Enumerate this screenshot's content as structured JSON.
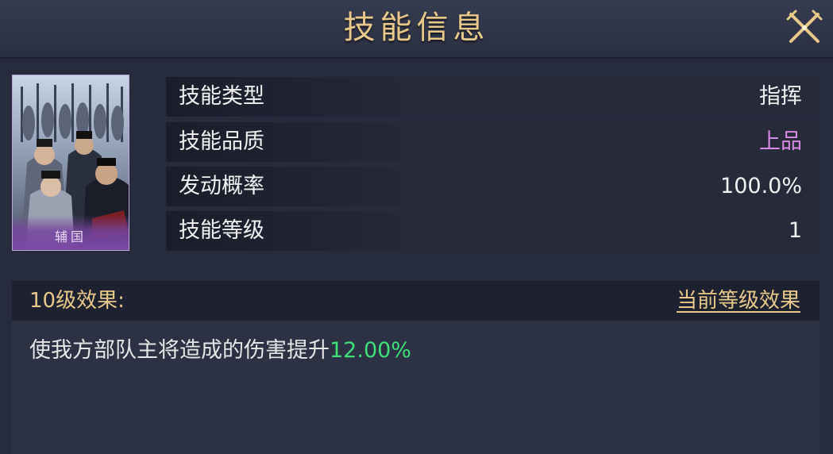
{
  "header": {
    "title": "技能信息",
    "close_icon": "close-crossed-swords-icon"
  },
  "card": {
    "name": "辅国",
    "frame_color": "#b9a8d8",
    "band_color": "#7a48a6"
  },
  "info_rows": [
    {
      "label": "技能类型",
      "value": "指挥",
      "value_color": "#f2f2f2"
    },
    {
      "label": "技能品质",
      "value": "上品",
      "value_color": "#d98ae6"
    },
    {
      "label": "发动概率",
      "value": "100.0%",
      "value_color": "#f2f2f2"
    },
    {
      "label": "技能等级",
      "value": "1",
      "value_color": "#f2f2f2"
    }
  ],
  "effect": {
    "title": "10级效果:",
    "link_label": "当前等级效果",
    "description_prefix": "使我方部队主将造成的伤害提升",
    "description_value": "12.00%",
    "highlight_color": "#3ee07a"
  },
  "colors": {
    "accent_gold": "#e8c98a",
    "panel_bg": "#262b3d"
  }
}
